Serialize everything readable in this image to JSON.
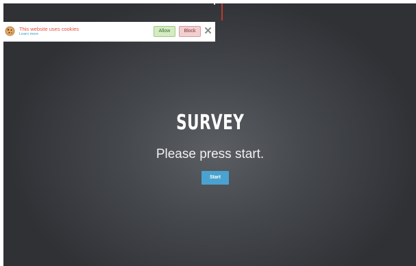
{
  "cookie_bar": {
    "message": "This website uses cookies",
    "learn_more": "Learn more",
    "allow_label": "Allow",
    "block_label": "Block",
    "close_symbol": "✕"
  },
  "survey": {
    "title": "SURVEY",
    "instruction": "Please press start.",
    "start_label": "Start"
  },
  "colors": {
    "background": "#45484d",
    "accent": "#4aa2d0",
    "cookie_text": "#e74c3c"
  },
  "icons": [
    "cookie-icon",
    "close-icon"
  ]
}
